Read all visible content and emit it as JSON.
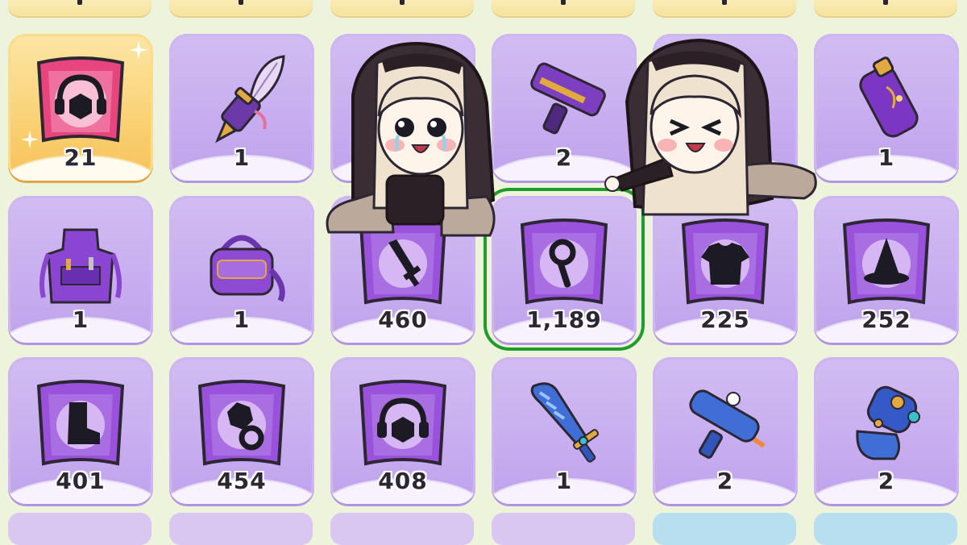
{
  "inventory": {
    "rows": [
      [
        {
          "name": "headset-material",
          "count": "21",
          "icon": "headset-icon",
          "rarity": "gold"
        },
        {
          "name": "feather-pen",
          "count": "1",
          "icon": "feather-pen-icon",
          "rarity": "purple"
        },
        {
          "name": "hidden-item",
          "count": "",
          "icon": "hidden",
          "rarity": "purple"
        },
        {
          "name": "plasma-gun",
          "count": "2",
          "icon": "plasma-gun-icon",
          "rarity": "purple"
        },
        {
          "name": "hidden-item",
          "count": "",
          "icon": "hidden",
          "rarity": "purple"
        },
        {
          "name": "potion-flask",
          "count": "1",
          "icon": "flask-icon",
          "rarity": "purple"
        }
      ],
      [
        {
          "name": "tool-apron",
          "count": "1",
          "icon": "apron-icon",
          "rarity": "purple"
        },
        {
          "name": "shoulder-bag",
          "count": "1",
          "icon": "bag-icon",
          "rarity": "purple"
        },
        {
          "name": "sword-material",
          "count": "460",
          "icon": "sword-icon",
          "rarity": "purple"
        },
        {
          "name": "magnifier-material",
          "count": "1,189",
          "icon": "magnifier-icon",
          "rarity": "purple",
          "selected": true
        },
        {
          "name": "shirt-material",
          "count": "225",
          "icon": "shirt-icon",
          "rarity": "purple"
        },
        {
          "name": "hat-material",
          "count": "252",
          "icon": "witch-hat-icon",
          "rarity": "purple"
        }
      ],
      [
        {
          "name": "boot-material",
          "count": "401",
          "icon": "boot-icon",
          "rarity": "purple"
        },
        {
          "name": "ring-material",
          "count": "454",
          "icon": "ring-icon",
          "rarity": "purple"
        },
        {
          "name": "headset-material",
          "count": "408",
          "icon": "headset-icon",
          "rarity": "purple"
        },
        {
          "name": "carrot-sword",
          "count": "1",
          "icon": "carrot-sword-icon",
          "rarity": "purple"
        },
        {
          "name": "bunny-blaster",
          "count": "2",
          "icon": "water-gun-icon",
          "rarity": "purple"
        },
        {
          "name": "robot-gauntlet",
          "count": "2",
          "icon": "gauntlet-icon",
          "rarity": "purple"
        }
      ]
    ]
  },
  "colors": {
    "background": "#eef4dc",
    "purple_tile": "#c5aaef",
    "gold_tile": "#f9cd6c",
    "selection": "#1f9d2c",
    "count_text": "#2d2633"
  }
}
